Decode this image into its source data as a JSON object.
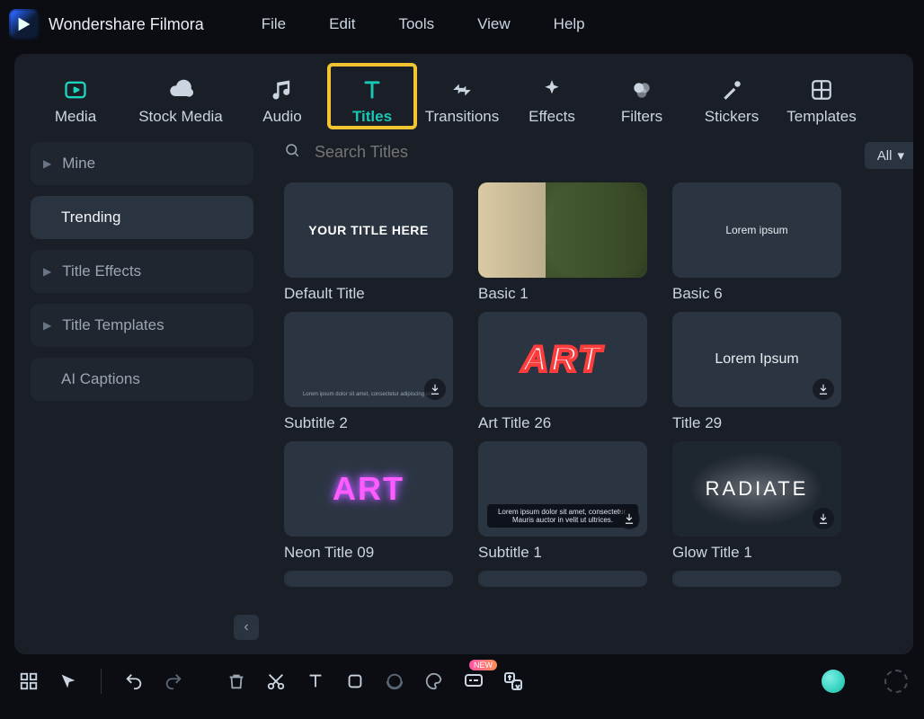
{
  "app": {
    "name": "Wondershare Filmora"
  },
  "menu": {
    "file": "File",
    "edit": "Edit",
    "tools": "Tools",
    "view": "View",
    "help": "Help"
  },
  "categories": {
    "media": "Media",
    "stock": "Stock Media",
    "audio": "Audio",
    "titles": "Titles",
    "transitions": "Transitions",
    "effects": "Effects",
    "filters": "Filters",
    "stickers": "Stickers",
    "templates": "Templates"
  },
  "sidebar": {
    "mine": "Mine",
    "trending": "Trending",
    "effects": "Title Effects",
    "templates": "Title Templates",
    "ai": "AI Captions"
  },
  "search": {
    "placeholder": "Search Titles"
  },
  "filter": {
    "label": "All"
  },
  "titles": {
    "default": {
      "label": "Default Title",
      "sample": "YOUR TITLE HERE"
    },
    "basic1": {
      "label": "Basic 1"
    },
    "basic6": {
      "label": "Basic 6",
      "sample": "Lorem ipsum"
    },
    "sub2": {
      "label": "Subtitle 2",
      "sample": "Lorem ipsum dolor sit amet, consectetur adipiscing elit."
    },
    "art26": {
      "label": "Art Title 26",
      "sample": "ART"
    },
    "title29": {
      "label": "Title 29",
      "sample": "Lorem Ipsum"
    },
    "neon09": {
      "label": "Neon Title 09",
      "sample": "ART"
    },
    "sub1": {
      "label": "Subtitle 1",
      "sample": "Lorem ipsum dolor sit amet, consectetur. Mauris auctor in velit ut ultrices."
    },
    "glow1": {
      "label": "Glow Title 1",
      "sample": "RADIATE"
    }
  },
  "badges": {
    "new": "NEW"
  }
}
